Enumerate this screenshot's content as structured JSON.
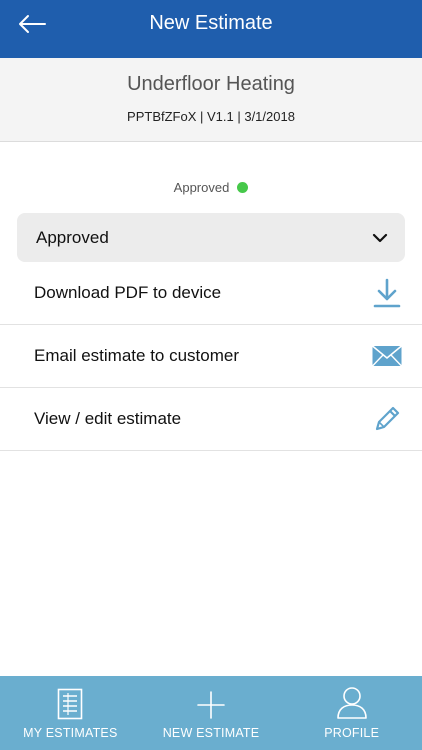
{
  "topbar": {
    "title": "New Estimate",
    "back_icon": "arrow-left-icon"
  },
  "estimate": {
    "title": "Underfloor Heating",
    "meta": "PPTBfZFoX | V1.1 | 3/1/2018"
  },
  "status": {
    "label": "Approved",
    "dot_color": "#46c84a"
  },
  "status_select": {
    "value": "Approved",
    "icon": "chevron-down-icon"
  },
  "actions": [
    {
      "label": "Download PDF to device",
      "icon": "download-icon"
    },
    {
      "label": "Email estimate to customer",
      "icon": "envelope-icon"
    },
    {
      "label": "View / edit estimate",
      "icon": "pencil-icon"
    }
  ],
  "tabbar": {
    "tabs": [
      {
        "label": "MY ESTIMATES",
        "icon": "document-list-icon"
      },
      {
        "label": "NEW ESTIMATE",
        "icon": "plus-icon"
      },
      {
        "label": "PROFILE",
        "icon": "user-icon"
      }
    ]
  },
  "colors": {
    "header_blue": "#1f5ead",
    "tabbar_blue": "#6aaecf",
    "icon_blue": "#5fa3cc"
  }
}
